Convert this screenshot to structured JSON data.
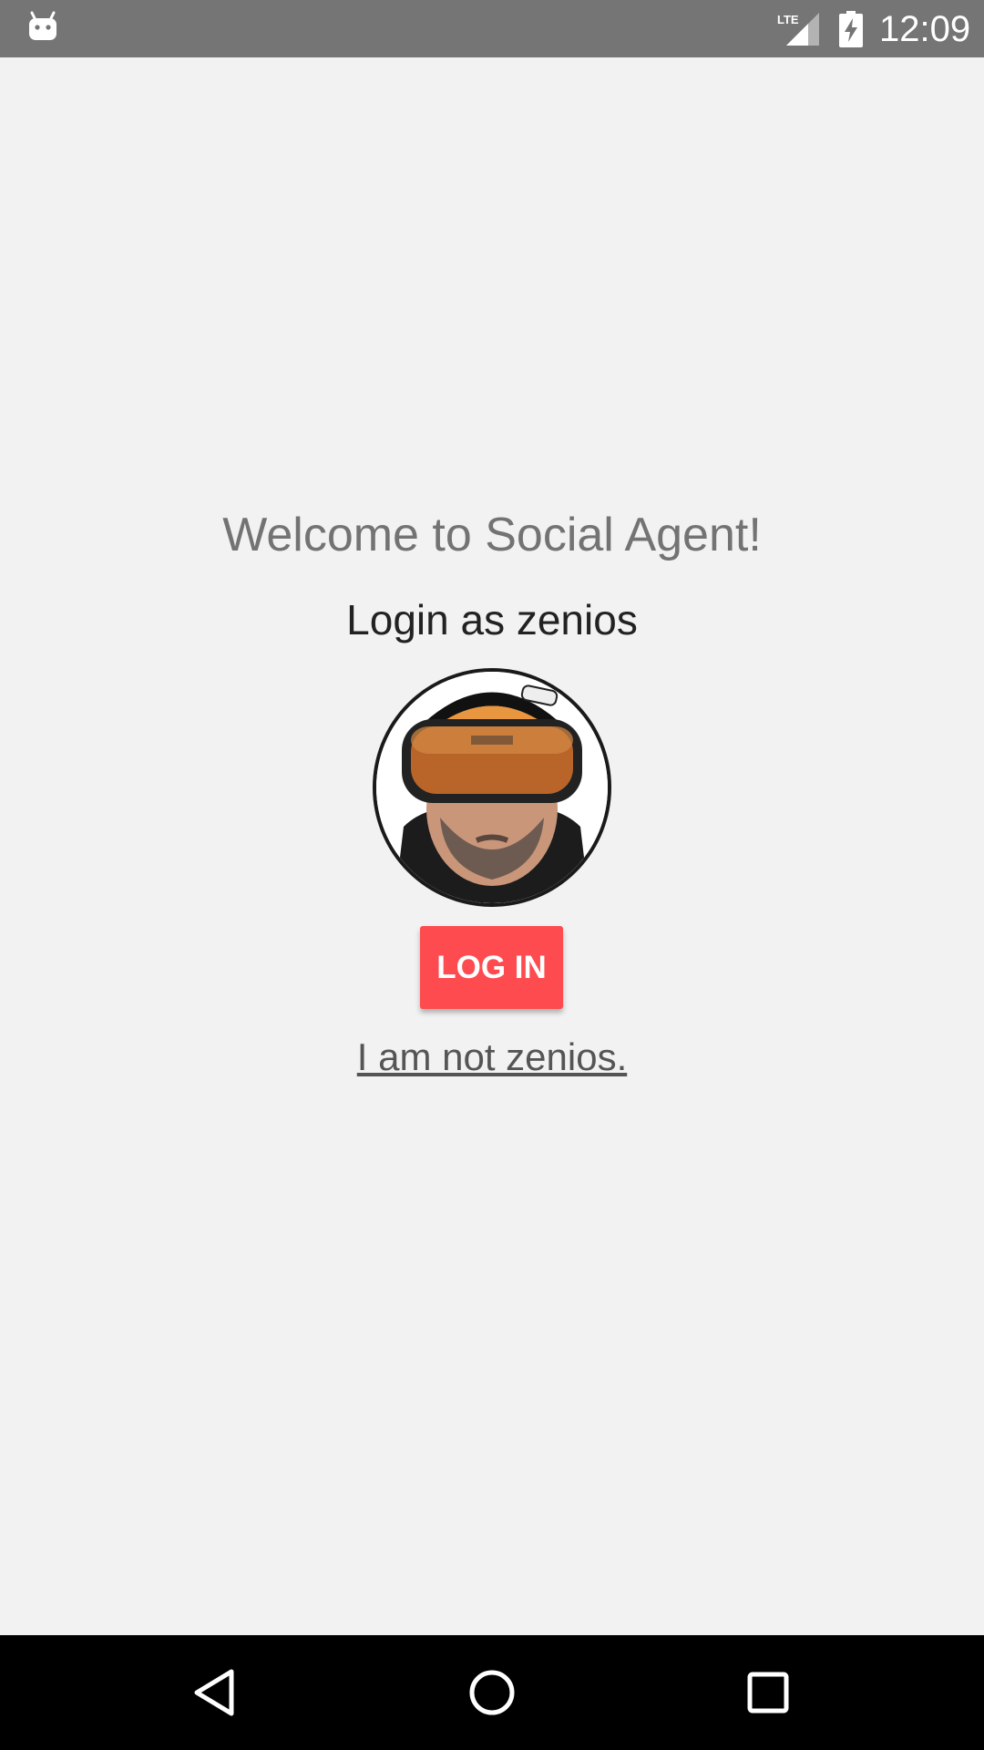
{
  "status_bar": {
    "time": "12:09",
    "network": "LTE",
    "icons": [
      "android-icon",
      "lte-signal-icon",
      "battery-charging-icon"
    ]
  },
  "main": {
    "welcome": "Welcome to Social Agent!",
    "login_as": "Login as zenios",
    "avatar": "helmet-goggles-avatar",
    "login_button": "LOG IN",
    "not_user_link": "I am not zenios."
  },
  "nav_bar": {
    "icons": [
      "back-icon",
      "home-icon",
      "recents-icon"
    ]
  },
  "colors": {
    "status_bar": "#757575",
    "background": "#f2f2f2",
    "accent": "#fe4b4f",
    "nav_bar": "#000000"
  }
}
